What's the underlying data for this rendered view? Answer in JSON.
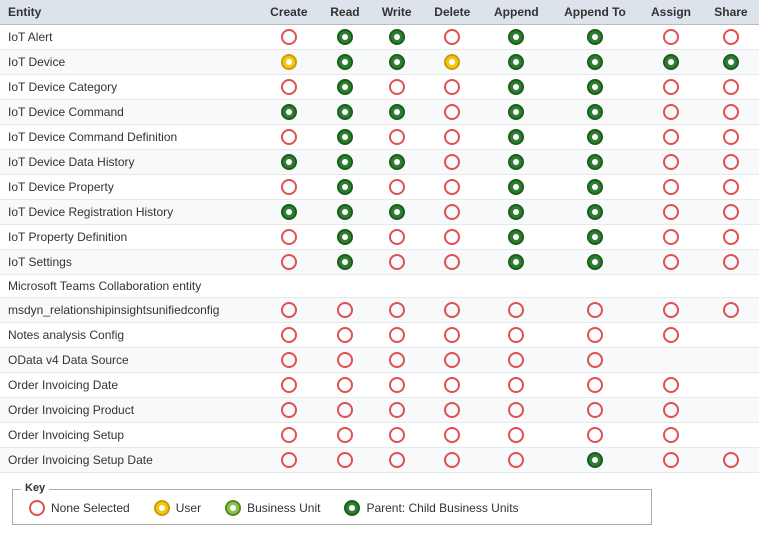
{
  "table": {
    "headers": [
      "Entity",
      "Create",
      "Read",
      "Write",
      "Delete",
      "Append",
      "Append To",
      "Assign",
      "Share"
    ],
    "rows": [
      {
        "entity": "IoT Alert",
        "create": "empty",
        "read": "green",
        "write": "green",
        "delete": "empty",
        "append": "green",
        "appendTo": "green",
        "assign": "empty",
        "share": "empty"
      },
      {
        "entity": "IoT Device",
        "create": "yellow",
        "read": "green",
        "write": "green",
        "delete": "yellow",
        "append": "green",
        "appendTo": "green",
        "assign": "green",
        "share": "green"
      },
      {
        "entity": "IoT Device Category",
        "create": "empty",
        "read": "green",
        "write": "empty",
        "delete": "empty",
        "append": "green",
        "appendTo": "green",
        "assign": "empty",
        "share": "empty"
      },
      {
        "entity": "IoT Device Command",
        "create": "green",
        "read": "green",
        "write": "green",
        "delete": "empty",
        "append": "green",
        "appendTo": "green",
        "assign": "empty",
        "share": "empty"
      },
      {
        "entity": "IoT Device Command Definition",
        "create": "empty",
        "read": "green",
        "write": "empty",
        "delete": "empty",
        "append": "green",
        "appendTo": "green",
        "assign": "empty",
        "share": "empty"
      },
      {
        "entity": "IoT Device Data History",
        "create": "green",
        "read": "green",
        "write": "green",
        "delete": "empty",
        "append": "green",
        "appendTo": "green",
        "assign": "empty",
        "share": "empty"
      },
      {
        "entity": "IoT Device Property",
        "create": "empty",
        "read": "green",
        "write": "empty",
        "delete": "empty",
        "append": "green",
        "appendTo": "green",
        "assign": "empty",
        "share": "empty"
      },
      {
        "entity": "IoT Device Registration History",
        "create": "green",
        "read": "green",
        "write": "green",
        "delete": "empty",
        "append": "green",
        "appendTo": "green",
        "assign": "empty",
        "share": "empty"
      },
      {
        "entity": "IoT Property Definition",
        "create": "empty",
        "read": "green",
        "write": "empty",
        "delete": "empty",
        "append": "green",
        "appendTo": "green",
        "assign": "empty",
        "share": "empty"
      },
      {
        "entity": "IoT Settings",
        "create": "empty",
        "read": "green",
        "write": "empty",
        "delete": "empty",
        "append": "green",
        "appendTo": "green",
        "assign": "empty",
        "share": "empty"
      },
      {
        "entity": "Microsoft Teams Collaboration entity",
        "create": "",
        "read": "",
        "write": "",
        "delete": "",
        "append": "",
        "appendTo": "",
        "assign": "",
        "share": ""
      },
      {
        "entity": "msdyn_relationshipinsightsunifiedconfig",
        "create": "empty",
        "read": "empty",
        "write": "empty",
        "delete": "empty",
        "append": "empty",
        "appendTo": "empty",
        "assign": "empty",
        "share": "empty"
      },
      {
        "entity": "Notes analysis Config",
        "create": "empty",
        "read": "empty",
        "write": "empty",
        "delete": "empty",
        "append": "empty",
        "appendTo": "empty",
        "assign": "empty",
        "share": ""
      },
      {
        "entity": "OData v4 Data Source",
        "create": "empty",
        "read": "empty",
        "write": "empty",
        "delete": "empty",
        "append": "empty",
        "appendTo": "empty",
        "assign": "",
        "share": ""
      },
      {
        "entity": "Order Invoicing Date",
        "create": "empty",
        "read": "empty",
        "write": "empty",
        "delete": "empty",
        "append": "empty",
        "appendTo": "empty",
        "assign": "empty",
        "share": ""
      },
      {
        "entity": "Order Invoicing Product",
        "create": "empty",
        "read": "empty",
        "write": "empty",
        "delete": "empty",
        "append": "empty",
        "appendTo": "empty",
        "assign": "empty",
        "share": ""
      },
      {
        "entity": "Order Invoicing Setup",
        "create": "empty",
        "read": "empty",
        "write": "empty",
        "delete": "empty",
        "append": "empty",
        "appendTo": "empty",
        "assign": "empty",
        "share": ""
      },
      {
        "entity": "Order Invoicing Setup Date",
        "create": "empty",
        "read": "empty",
        "write": "empty",
        "delete": "empty",
        "append": "empty",
        "appendTo": "green",
        "assign": "empty",
        "share": "empty"
      }
    ]
  },
  "key": {
    "title": "Key",
    "items": [
      {
        "type": "empty",
        "label": "None Selected"
      },
      {
        "type": "yellow",
        "label": "User"
      },
      {
        "type": "yellow2",
        "label": "Business Unit"
      },
      {
        "type": "green",
        "label": "Parent: Child Business Units"
      }
    ]
  }
}
